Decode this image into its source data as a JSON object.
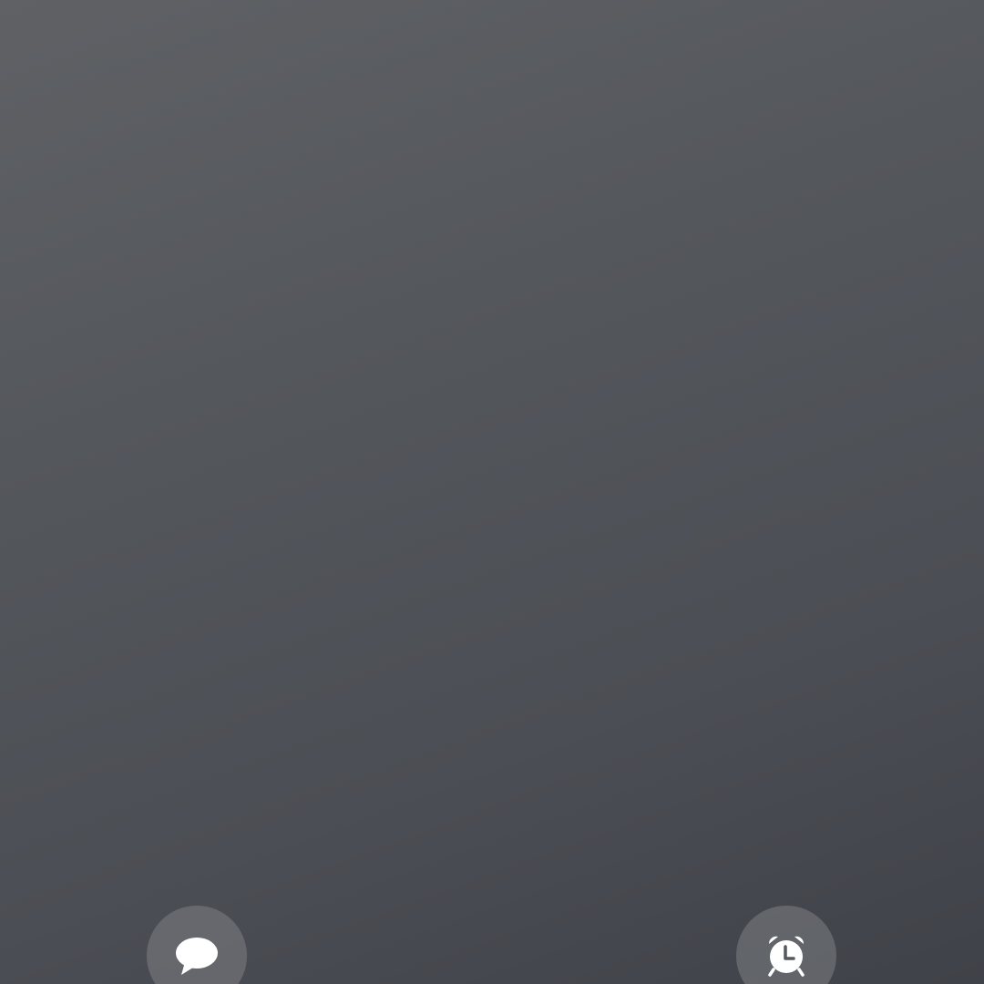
{
  "lockscreen": {
    "background_top": "#5f6165",
    "background_bottom": "#3f4248",
    "shortcuts": [
      {
        "name": "messages",
        "icon": "speech-bubble-icon"
      },
      {
        "name": "alarm",
        "icon": "alarm-clock-icon"
      }
    ]
  }
}
